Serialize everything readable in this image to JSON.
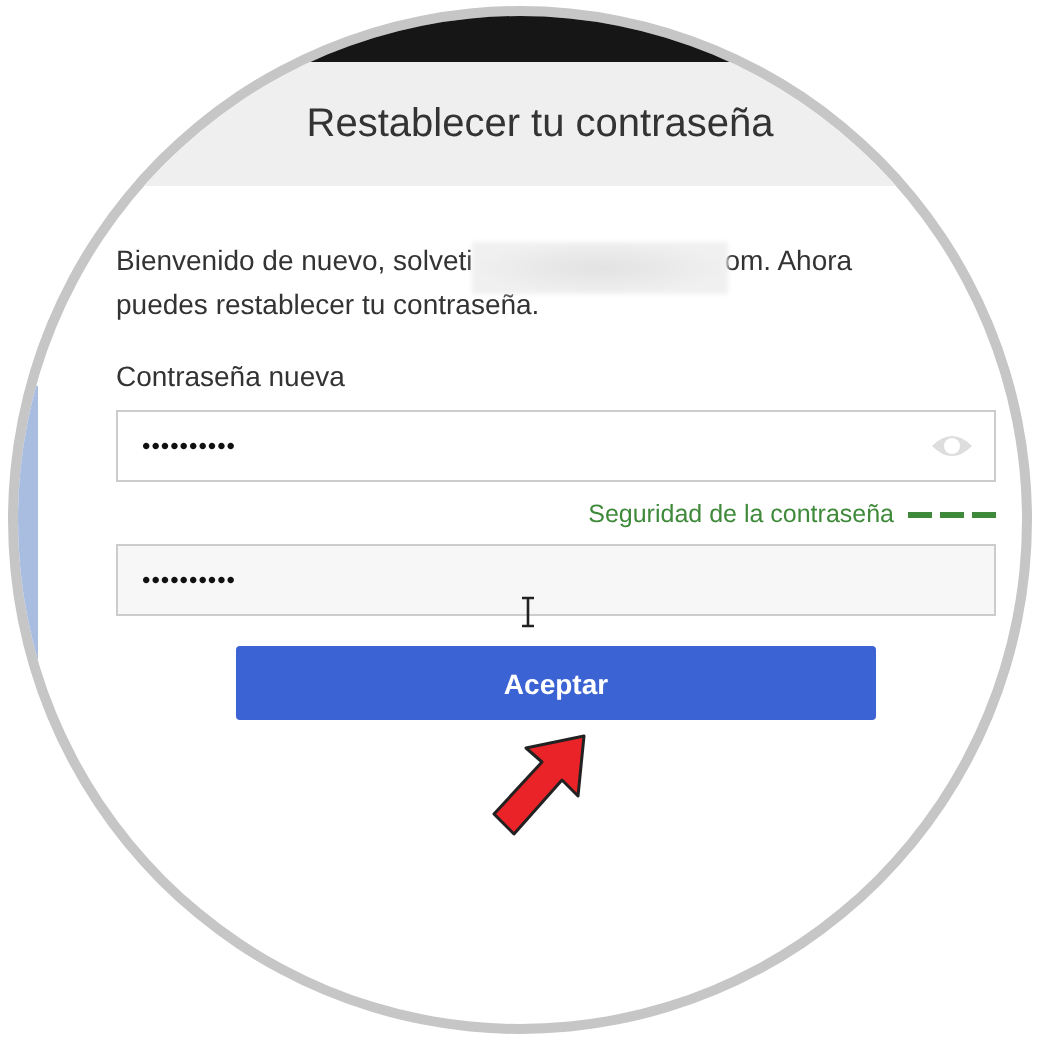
{
  "dialog": {
    "title": "Restablecer tu contraseña"
  },
  "message": {
    "text_before": "Bienvenido de nuevo, solveti",
    "redacted": true,
    "text_after": "om. Ahora puedes restablecer tu contraseña."
  },
  "fields": [
    {
      "label": "Contraseña nueva",
      "value": "••••••••••",
      "reveal_icon": true,
      "focused": false
    },
    {
      "value": "••••••••••",
      "reveal_icon": false,
      "focused": true
    }
  ],
  "strength": {
    "label": "Seguridad de la contraseña",
    "segments": [
      {
        "filled": true
      },
      {
        "filled": true
      },
      {
        "filled": true
      }
    ]
  },
  "button": {
    "label": "Aceptar"
  }
}
